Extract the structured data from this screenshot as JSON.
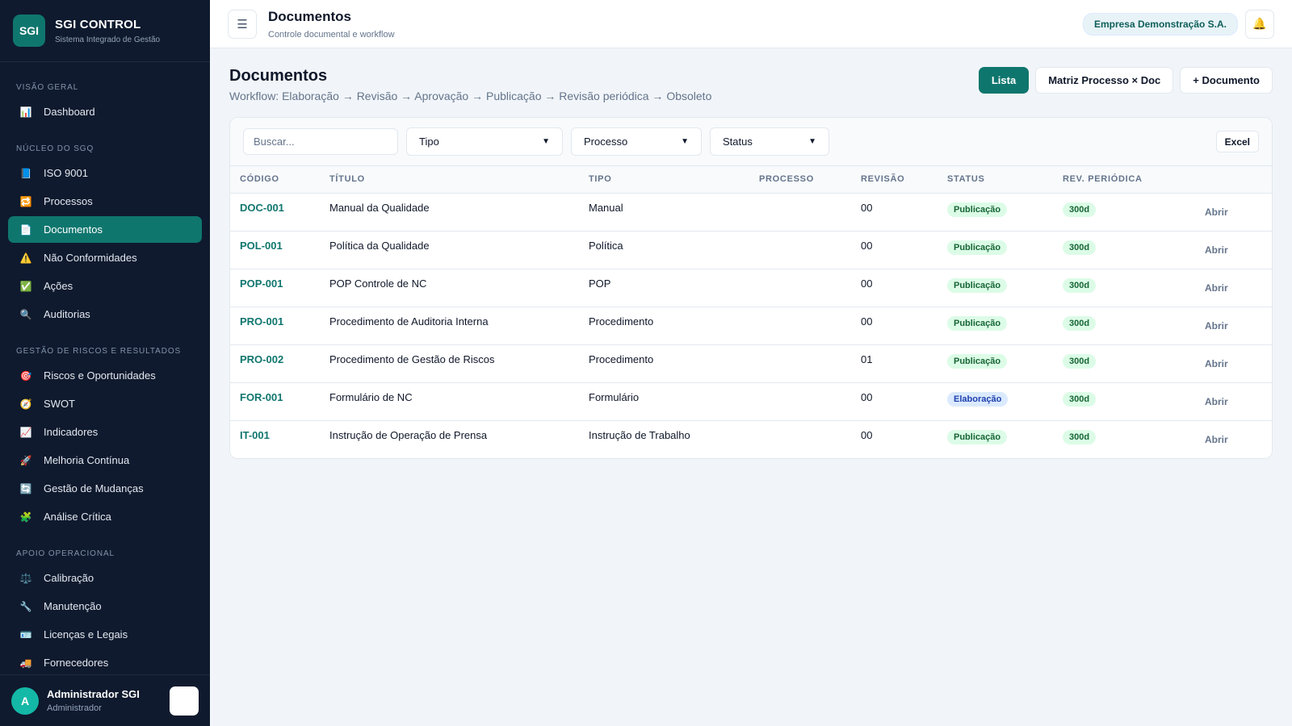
{
  "brand": {
    "logo": "SGI",
    "title": "SGI CONTROL",
    "subtitle": "Sistema Integrado de Gestão"
  },
  "sidebar": {
    "sections": [
      {
        "label": "VISÃO GERAL",
        "items": [
          {
            "label": "Dashboard",
            "icon": "📊",
            "icon_name": "chart-icon"
          }
        ]
      },
      {
        "label": "NÚCLEO DO SGQ",
        "items": [
          {
            "label": "ISO 9001",
            "icon": "📘",
            "icon_name": "book-icon"
          },
          {
            "label": "Processos",
            "icon": "🔁",
            "icon_name": "repeat-icon"
          },
          {
            "label": "Documentos",
            "icon": "📄",
            "icon_name": "document-icon",
            "active": true
          },
          {
            "label": "Não Conformidades",
            "icon": "⚠️",
            "icon_name": "warning-icon"
          },
          {
            "label": "Ações",
            "icon": "✅",
            "icon_name": "check-icon"
          },
          {
            "label": "Auditorias",
            "icon": "🔍",
            "icon_name": "magnifier-icon"
          }
        ]
      },
      {
        "label": "GESTÃO DE RISCOS E RESULTADOS",
        "items": [
          {
            "label": "Riscos e Oportunidades",
            "icon": "🎯",
            "icon_name": "target-icon"
          },
          {
            "label": "SWOT",
            "icon": "🧭",
            "icon_name": "compass-icon"
          },
          {
            "label": "Indicadores",
            "icon": "📈",
            "icon_name": "trend-icon"
          },
          {
            "label": "Melhoria Contínua",
            "icon": "🚀",
            "icon_name": "rocket-icon"
          },
          {
            "label": "Gestão de Mudanças",
            "icon": "🔄",
            "icon_name": "cycle-icon"
          },
          {
            "label": "Análise Crítica",
            "icon": "🧩",
            "icon_name": "puzzle-icon"
          }
        ]
      },
      {
        "label": "APOIO OPERACIONAL",
        "items": [
          {
            "label": "Calibração",
            "icon": "⚖️",
            "icon_name": "scale-icon"
          },
          {
            "label": "Manutenção",
            "icon": "🔧",
            "icon_name": "wrench-icon"
          },
          {
            "label": "Licenças e Legais",
            "icon": "🪪",
            "icon_name": "id-card-icon"
          },
          {
            "label": "Fornecedores",
            "icon": "🚚",
            "icon_name": "truck-icon"
          },
          {
            "label": "Clientes",
            "icon": "🤝",
            "icon_name": "handshake-icon"
          }
        ]
      }
    ]
  },
  "user": {
    "initial": "A",
    "name": "Administrador SGI",
    "role": "Administrador",
    "logout_icon": ""
  },
  "topbar": {
    "menu_icon": "☰",
    "title": "Documentos",
    "subtitle": "Controle documental e workflow",
    "company": "Empresa Demonstração S.A.",
    "bell_icon": "🔔"
  },
  "page": {
    "title": "Documentos",
    "workflow": "Workflow: Elaboração → Revisão → Aprovação → Publicação → Revisão periódica → Obsoleto",
    "actions": {
      "list": "Lista",
      "matrix": "Matriz Processo × Doc",
      "new_doc": "+ Documento"
    }
  },
  "filters": {
    "search_placeholder": "Buscar...",
    "type": "Tipo",
    "process": "Processo",
    "status": "Status",
    "excel": "Excel"
  },
  "table": {
    "headers": {
      "code": "CÓDIGO",
      "title": "TÍTULO",
      "type": "TIPO",
      "process": "PROCESSO",
      "revision": "REVISÃO",
      "status": "STATUS",
      "periodic": "REV. PERIÓDICA"
    },
    "rows": [
      {
        "code": "DOC-001",
        "title": "Manual da Qualidade",
        "type": "Manual",
        "process": "",
        "revision": "00",
        "status": "Publicação",
        "status_kind": "pub",
        "periodic": "300d",
        "action": "Abrir"
      },
      {
        "code": "POL-001",
        "title": "Política da Qualidade",
        "type": "Política",
        "process": "",
        "revision": "00",
        "status": "Publicação",
        "status_kind": "pub",
        "periodic": "300d",
        "action": "Abrir"
      },
      {
        "code": "POP-001",
        "title": "POP Controle de NC",
        "type": "POP",
        "process": "",
        "revision": "00",
        "status": "Publicação",
        "status_kind": "pub",
        "periodic": "300d",
        "action": "Abrir"
      },
      {
        "code": "PRO-001",
        "title": "Procedimento de Auditoria Interna",
        "type": "Procedimento",
        "process": "",
        "revision": "00",
        "status": "Publicação",
        "status_kind": "pub",
        "periodic": "300d",
        "action": "Abrir"
      },
      {
        "code": "PRO-002",
        "title": "Procedimento de Gestão de Riscos",
        "type": "Procedimento",
        "process": "",
        "revision": "01",
        "status": "Publicação",
        "status_kind": "pub",
        "periodic": "300d",
        "action": "Abrir"
      },
      {
        "code": "FOR-001",
        "title": "Formulário de NC",
        "type": "Formulário",
        "process": "",
        "revision": "00",
        "status": "Elaboração",
        "status_kind": "elab",
        "periodic": "300d",
        "action": "Abrir"
      },
      {
        "code": "IT-001",
        "title": "Instrução de Operação de Prensa",
        "type": "Instrução de Trabalho",
        "process": "",
        "revision": "00",
        "status": "Publicação",
        "status_kind": "pub",
        "periodic": "300d",
        "action": "Abrir"
      }
    ]
  },
  "colors": {
    "sidebar_bg": "#0f1a2e",
    "accent": "#0f766e",
    "badge_pub": "#dcfce7",
    "badge_elab": "#dbeafe"
  }
}
